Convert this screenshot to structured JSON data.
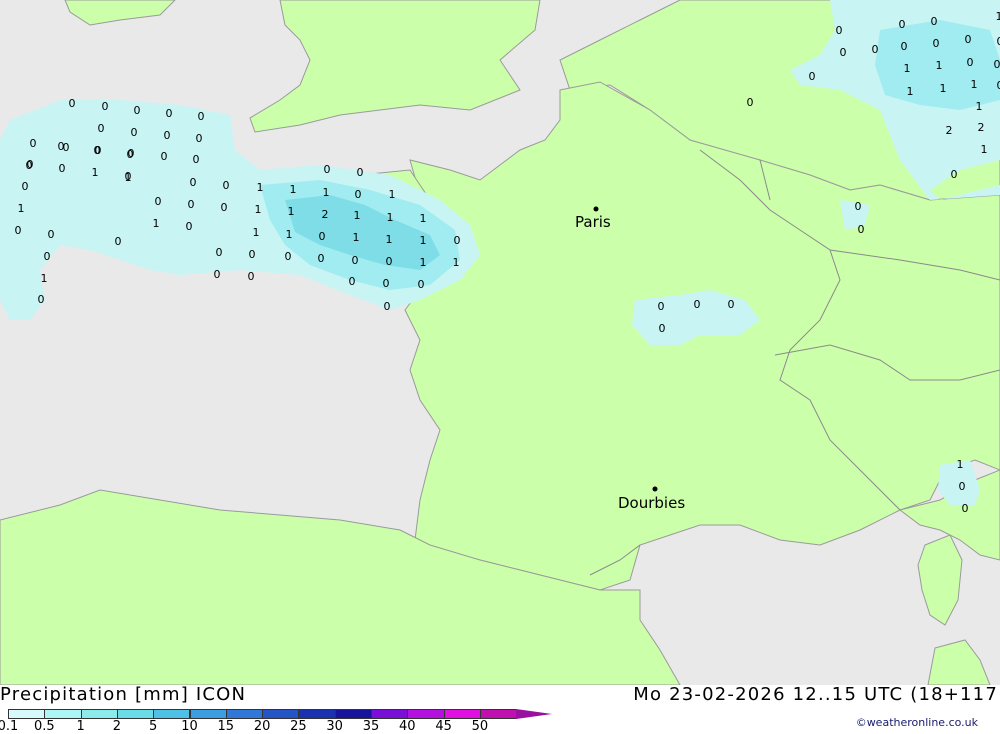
{
  "header": {
    "title_left": "Precipitation [mm] ICON",
    "title_right": "Mo 23-02-2026 12..15 UTC (18+117"
  },
  "legend": {
    "labels": [
      "0.1",
      "0.5",
      "1",
      "2",
      "5",
      "10",
      "15",
      "20",
      "25",
      "30",
      "35",
      "40",
      "45",
      "50"
    ],
    "colors": [
      "#d7fbfb",
      "#aef6f6",
      "#8cecec",
      "#6bdbe8",
      "#4fc1e6",
      "#3c9ee0",
      "#2f78d8",
      "#2554c7",
      "#1b32b0",
      "#15149a",
      "#7a10d8",
      "#b410e0",
      "#e010e0",
      "#c010b0",
      "#9a10a0"
    ]
  },
  "credit": "©weatheronline.co.uk",
  "cities": [
    {
      "name": "Paris"
    },
    {
      "name": "Dourbies"
    }
  ],
  "colors": {
    "sea": "#e9e9ea",
    "land": "#ccff aa",
    "land_fill": "#ccffaa",
    "border": "#9a9a9a",
    "precip_light": "#c8f4f4",
    "precip_mid": "#a0ecf0",
    "precip_strong": "#7fdde8"
  },
  "precip_values": [
    "0",
    "0",
    "0",
    "0",
    "0",
    "0",
    "0",
    "0",
    "0",
    "0",
    "0",
    "0",
    "0",
    "0",
    "0",
    "0",
    "0",
    "1",
    "0",
    "0",
    "0",
    "0",
    "0",
    "0",
    "0",
    "1",
    "1",
    "0",
    "0",
    "0",
    "0",
    "0",
    "0",
    "0",
    "1",
    "0",
    "0",
    "0",
    "0",
    "0",
    "0",
    "0",
    "0",
    "0",
    "0",
    "0",
    "0",
    "0",
    "1",
    "1",
    "1",
    "1",
    "0",
    "1",
    "1",
    "2",
    "1",
    "1",
    "1",
    "1",
    "1",
    "0",
    "1",
    "1",
    "1",
    "0",
    "0",
    "0",
    "0",
    "0",
    "1",
    "1",
    "0",
    "0",
    "0",
    "0",
    "0",
    "0",
    "0",
    "0",
    "0",
    "0",
    "0",
    "0",
    "0",
    "1",
    "1",
    "0",
    "0",
    "1",
    "1",
    "1",
    "1",
    "2",
    "2",
    "1",
    "1",
    "0",
    "0",
    "1",
    "0",
    "0",
    "0",
    "0",
    "0",
    "1",
    "0",
    "0",
    "0",
    "0"
  ]
}
